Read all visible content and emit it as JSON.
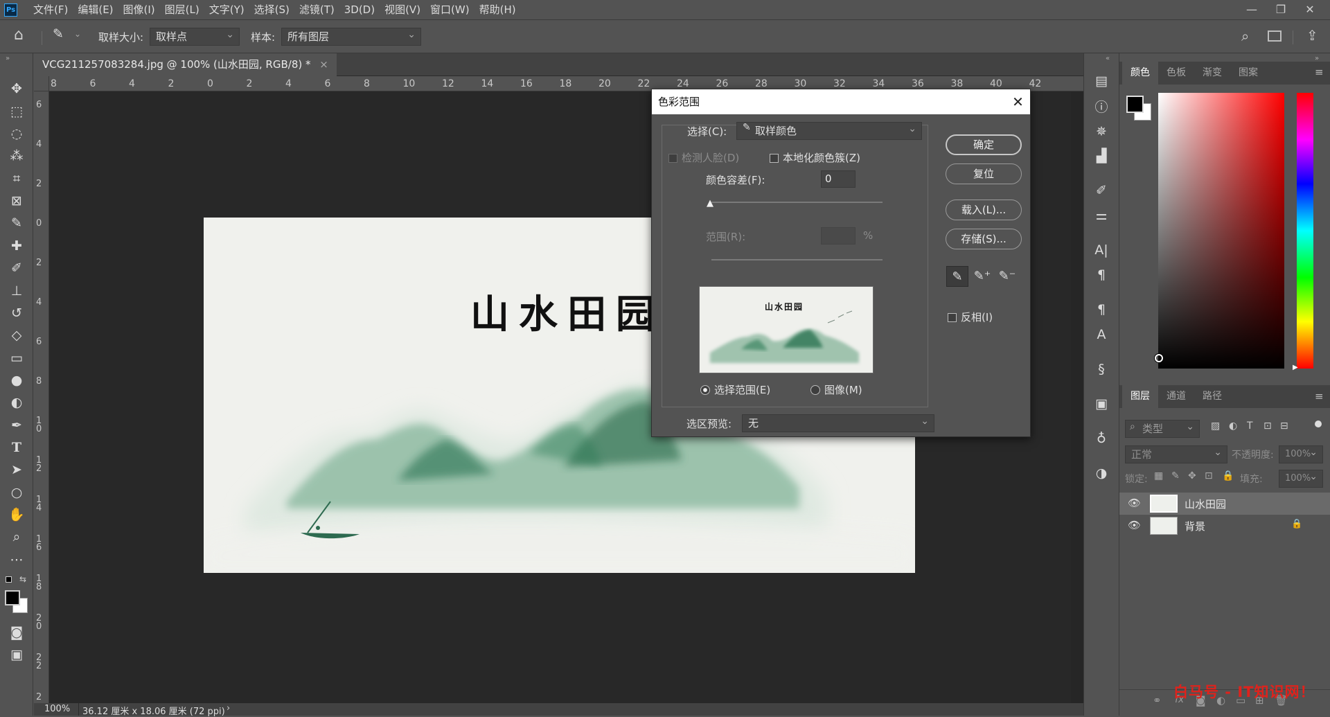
{
  "app": {
    "logo": "Ps"
  },
  "menu": [
    "文件(F)",
    "编辑(E)",
    "图像(I)",
    "图层(L)",
    "文字(Y)",
    "选择(S)",
    "滤镜(T)",
    "3D(D)",
    "视图(V)",
    "窗口(W)",
    "帮助(H)"
  ],
  "window_controls": {
    "minimize": "—",
    "restore": "❐",
    "close": "✕"
  },
  "options": {
    "sample_size_label": "取样大小:",
    "sample_size_value": "取样点",
    "sample_label": "样本:",
    "sample_value": "所有图层"
  },
  "document": {
    "tab_title": "VCG211257083284.jpg @ 100% (山水田园, RGB/8) *",
    "tab_close": "×",
    "canvas_title": "山水田园",
    "zoom": "100%",
    "doc_size": "36.12 厘米 x 18.06 厘米 (72 ppi)"
  },
  "ruler_top": [
    "8",
    "6",
    "4",
    "2",
    "0",
    "2",
    "4",
    "6",
    "8",
    "10",
    "12",
    "14",
    "16",
    "18",
    "20",
    "22",
    "24",
    "26",
    "28",
    "30",
    "32",
    "34",
    "36",
    "38",
    "40",
    "42"
  ],
  "ruler_left": [
    "6",
    "4",
    "2",
    "0",
    "2",
    "4",
    "6",
    "8",
    "10",
    "12",
    "14",
    "16",
    "18",
    "20",
    "22",
    "2"
  ],
  "color_panel": {
    "tabs": [
      "颜色",
      "色板",
      "渐变",
      "图案"
    ]
  },
  "layers_panel": {
    "tabs": [
      "图层",
      "通道",
      "路径"
    ],
    "filter_placeholder": "类型",
    "blend_mode": "正常",
    "opacity_label": "不透明度:",
    "opacity_value": "100%",
    "lock_label": "锁定:",
    "fill_label": "填充:",
    "fill_value": "100%",
    "layers": [
      {
        "name": "山水田园",
        "locked": false,
        "selected": true
      },
      {
        "name": "背景",
        "locked": true,
        "selected": false
      }
    ]
  },
  "dialog": {
    "title": "色彩范围",
    "select_label": "选择(C):",
    "select_value": "取样颜色",
    "detect_faces": "检测人脸(D)",
    "localized": "本地化颜色簇(Z)",
    "fuzziness_label": "颜色容差(F):",
    "fuzziness_value": "0",
    "range_label": "范围(R):",
    "range_unit": "%",
    "preview_title": "山水田园",
    "radio_selection": "选择范围(E)",
    "radio_image": "图像(M)",
    "selection_preview_label": "选区预览:",
    "selection_preview_value": "无",
    "ok": "确定",
    "reset": "复位",
    "load": "载入(L)...",
    "save": "存储(S)...",
    "invert": "反相(I)"
  },
  "watermark": "白马号 - IT知识网！",
  "colors": {
    "accent": "#31a8ff",
    "panel": "#535353",
    "dark": "#262626",
    "watermark": "#e0221c"
  }
}
